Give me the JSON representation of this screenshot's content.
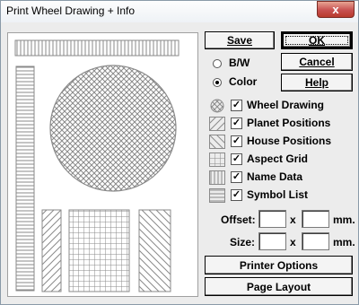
{
  "window": {
    "title": "Print Wheel Drawing + Info",
    "close_label": "x"
  },
  "buttons": {
    "save": "Save",
    "ok": "OK",
    "cancel": "Cancel",
    "help": "Help",
    "printer_options": "Printer Options",
    "page_layout": "Page Layout"
  },
  "mode": {
    "options": [
      "B/W",
      "Color"
    ],
    "selected": "Color"
  },
  "print_options": [
    {
      "label": "Wheel Drawing",
      "checked": true,
      "icon": "wheel-icon"
    },
    {
      "label": "Planet Positions",
      "checked": true,
      "icon": "planet-positions-icon"
    },
    {
      "label": "House Positions",
      "checked": true,
      "icon": "house-positions-icon"
    },
    {
      "label": "Aspect Grid",
      "checked": true,
      "icon": "aspect-grid-icon"
    },
    {
      "label": "Name Data",
      "checked": true,
      "icon": "name-data-icon"
    },
    {
      "label": "Symbol List",
      "checked": true,
      "icon": "symbol-list-icon"
    }
  ],
  "offset": {
    "label": "Offset:",
    "x_value": "",
    "y_value": ""
  },
  "size": {
    "label": "Size:",
    "x_value": "",
    "y_value": ""
  },
  "separator": "x",
  "unit": "mm.",
  "check_mark": "✓",
  "colors": {
    "accent": "#000000",
    "preview_stroke": "#8a8a8a",
    "close": "#c75050"
  }
}
